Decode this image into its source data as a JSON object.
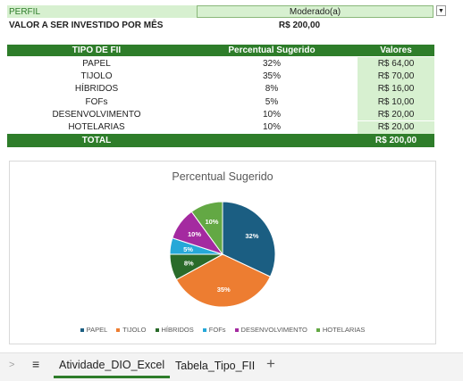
{
  "profile": {
    "label": "PERFIL",
    "value": "Moderado(a)"
  },
  "investment": {
    "label": "VALOR A SER INVESTIDO POR MÊS",
    "value": "R$ 200,00"
  },
  "table": {
    "headers": [
      "TIPO DE FII",
      "Percentual Sugerido",
      "Valores"
    ],
    "rows": [
      {
        "type": "PAPEL",
        "percent": "32%",
        "value": "R$ 64,00"
      },
      {
        "type": "TIJOLO",
        "percent": "35%",
        "value": "R$ 70,00"
      },
      {
        "type": "HÍBRIDOS",
        "percent": "8%",
        "value": "R$ 16,00"
      },
      {
        "type": "FOFs",
        "percent": "5%",
        "value": "R$ 10,00"
      },
      {
        "type": "DESENVOLVIMENTO",
        "percent": "10%",
        "value": "R$ 20,00"
      },
      {
        "type": "HOTELARIAS",
        "percent": "10%",
        "value": "R$ 20,00"
      }
    ],
    "total_label": "TOTAL",
    "total_value": "R$ 200,00"
  },
  "chart_data": {
    "type": "pie",
    "title": "Percentual Sugerido",
    "categories": [
      "PAPEL",
      "TIJOLO",
      "HÍBRIDOS",
      "FOFs",
      "DESENVOLVIMENTO",
      "HOTELARIAS"
    ],
    "values": [
      32,
      35,
      8,
      5,
      10,
      10
    ],
    "labels": [
      "32%",
      "35%",
      "8%",
      "5%",
      "10%",
      "10%"
    ],
    "colors": [
      "#1b5e82",
      "#ed7d31",
      "#2a6b2a",
      "#26a8d8",
      "#a42aa0",
      "#63a844"
    ],
    "legend_position": "bottom"
  },
  "tabs": {
    "active": "Atividade_DIO_Excel",
    "other": "Tabela_Tipo_FII"
  }
}
